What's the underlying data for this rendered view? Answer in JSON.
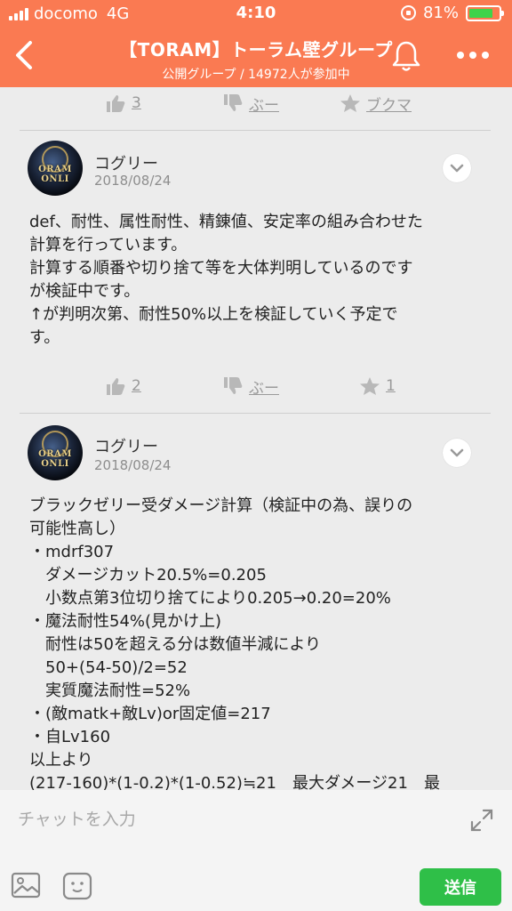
{
  "status_bar": {
    "carrier": "docomo",
    "network": "4G",
    "time": "4:10",
    "battery": "81%",
    "battery_level": 0.81
  },
  "header": {
    "title": "【TORAM】トーラム壁グループ",
    "subtitle": "公開グループ / 14972人が参加中",
    "back_icon": "chevron-left-icon",
    "bell_icon": "bell-icon",
    "more_icon": "more-dots-icon"
  },
  "top_reactions": {
    "likes": "3",
    "boo": "ぶー",
    "bookmark": "ブクマ"
  },
  "posts": [
    {
      "author": "コグリー",
      "date": "2018/08/24",
      "avatar_text": "ORAM ONLI",
      "body": "def、耐性、属性耐性、精錬値、安定率の組み合わせた\n計算を行っています。\n計算する順番や切り捨て等を大体判明しているのです\nが検証中です。\n↑が判明次第、耐性50%以上を検証していく予定で\nす。",
      "reactions": {
        "likes": "2",
        "boo": "ぶー",
        "bookmarks": "1"
      }
    },
    {
      "author": "コグリー",
      "date": "2018/08/24",
      "avatar_text": "ORAM ONLI",
      "body": "ブラックゼリー受ダメージ計算（検証中の為、誤りの\n可能性高し）\n・mdrf307\n　ダメージカット20.5%=0.205\n　小数点第3位切り捨てにより0.205→0.20=20%\n・魔法耐性54%(見かけ上)\n　耐性は50を超える分は数値半減により\n　50+(54-50)/2=52\n　実質魔法耐性=52%\n・(敵matk+敵Lv)or固定値=217\n・自Lv160\n以上より\n(217-160)*(1-0.2)*(1-0.52)≒21　最大ダメージ21　最"
    }
  ],
  "input_bar": {
    "placeholder": "チャットを入力",
    "send_label": "送信"
  },
  "colors": {
    "header_bg": "#fa7a52",
    "page_bg": "#ececec",
    "send_button": "#2fbf48",
    "battery_fill": "#3ed34a"
  }
}
